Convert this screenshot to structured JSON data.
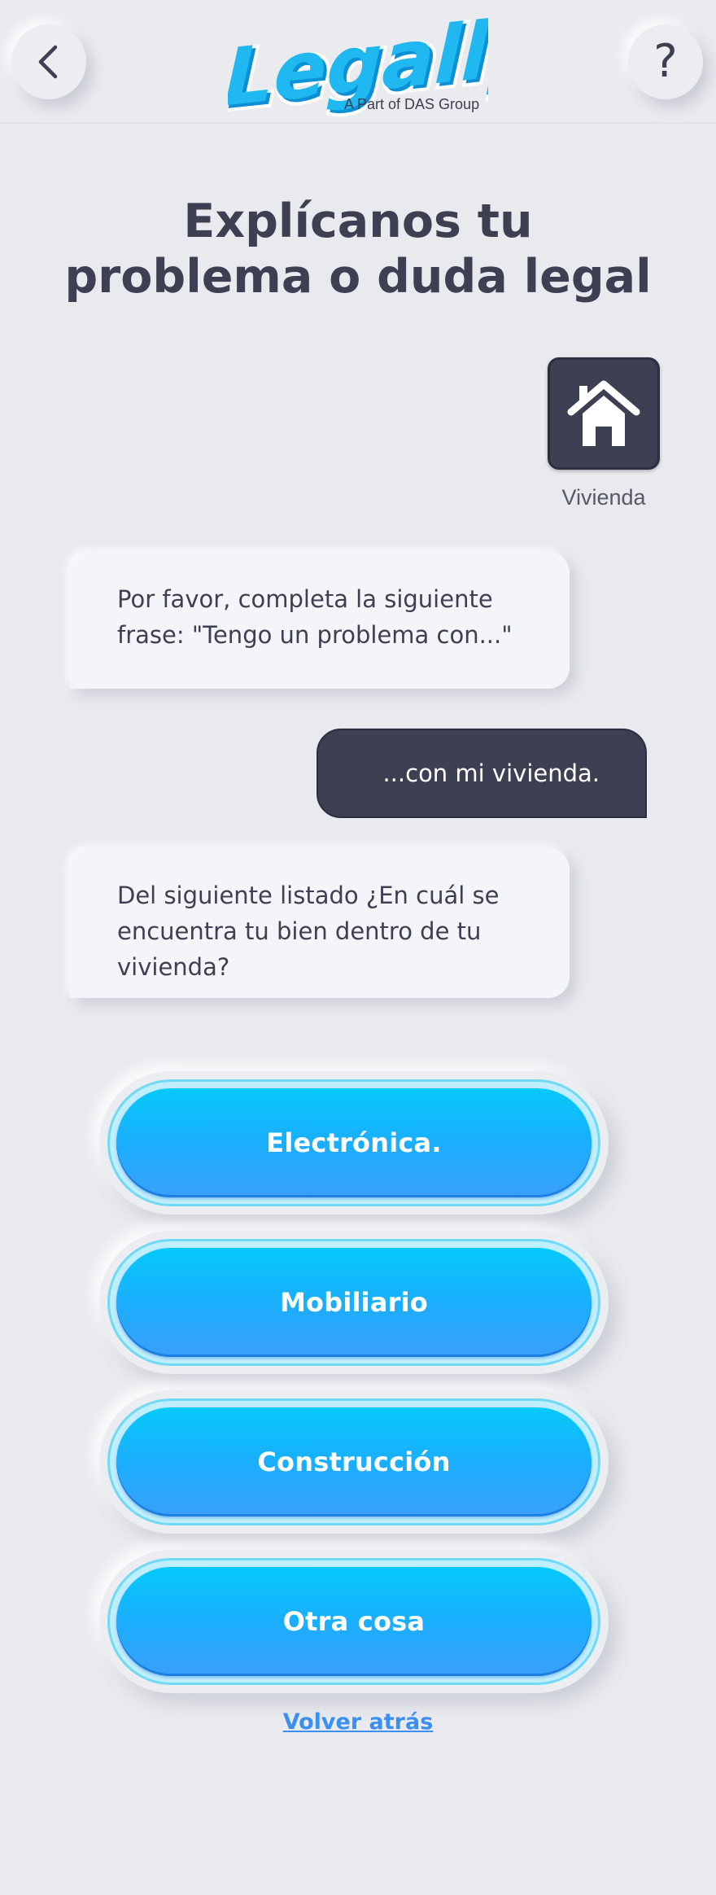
{
  "header": {
    "back_icon": "chevron-left-icon",
    "help_label": "?",
    "logo_text": "Legally",
    "logo_subtitle": "A Part of DAS Group",
    "colors": {
      "logo_primary": "#1fb8f0",
      "logo_dark": "#0d8fd6"
    }
  },
  "main": {
    "title_line1": "Explícanos tu",
    "title_line2": "problema o duda legal",
    "category": {
      "icon": "house-icon",
      "label": "Vivienda"
    },
    "messages": [
      {
        "from": "bot",
        "text": "Por favor, completa la siguiente frase: \"Tengo un problema con...\""
      },
      {
        "from": "user",
        "text": "...con mi vivienda."
      },
      {
        "from": "bot",
        "text": "Del siguiente listado ¿En cuál se encuentra tu bien dentro de tu vivienda?"
      }
    ],
    "options": [
      {
        "label": "Electrónica."
      },
      {
        "label": "Mobiliario"
      },
      {
        "label": "Construcción"
      },
      {
        "label": "Otra cosa"
      }
    ],
    "back_link": "Volver atrás"
  },
  "colors": {
    "background": "#e9eaee",
    "dark": "#3d4052",
    "button_gradient_top": "#06c9fb",
    "button_gradient_bottom": "#3aa0fa",
    "link": "#3a8ff0"
  }
}
